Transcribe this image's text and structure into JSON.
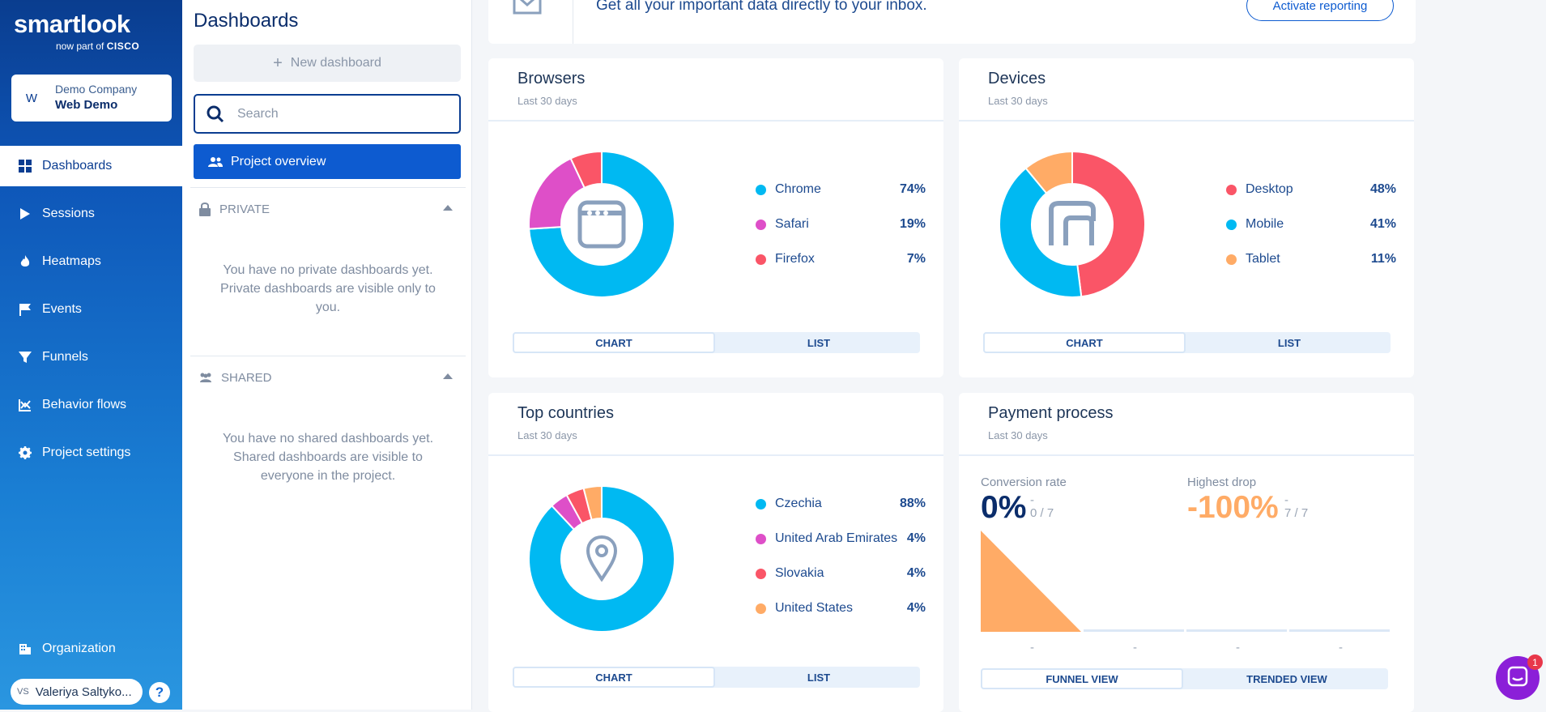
{
  "logo": {
    "brand": "smartlook",
    "sub_prefix": "now part of",
    "sub_brand": "CISCO"
  },
  "company": {
    "avatar": "W",
    "name": "Demo Company",
    "project": "Web Demo"
  },
  "nav": [
    {
      "label": "Dashboards",
      "icon": "grid-icon",
      "active": true
    },
    {
      "label": "Sessions",
      "icon": "play-icon"
    },
    {
      "label": "Heatmaps",
      "icon": "flame-icon"
    },
    {
      "label": "Events",
      "icon": "flag-icon"
    },
    {
      "label": "Funnels",
      "icon": "funnel-icon"
    },
    {
      "label": "Behavior flows",
      "icon": "flow-icon"
    },
    {
      "label": "Project settings",
      "icon": "gear-icon"
    }
  ],
  "organization": {
    "label": "Organization",
    "icon": "building-icon"
  },
  "user": {
    "initials": "VS",
    "name": "Valeriya Saltyko..."
  },
  "help": "?",
  "dashboards": {
    "title": "Dashboards",
    "new_label": "New dashboard",
    "search_placeholder": "Search",
    "project_overview": "Project overview",
    "private": {
      "label": "PRIVATE",
      "empty": "You have no private dashboards yet. Private dashboards are visible only to you."
    },
    "shared": {
      "label": "SHARED",
      "empty": "You have no shared dashboards yet. Shared dashboards are visible to everyone in the project."
    }
  },
  "reporting": {
    "text": "Get all your important data directly to your inbox.",
    "button": "Activate reporting"
  },
  "colors": {
    "blue": "#00b9f2",
    "magenta": "#de4fc8",
    "red": "#fa5567",
    "orange": "#ffab66",
    "accent": "#0d5bd0"
  },
  "cards": {
    "browsers": {
      "title": "Browsers",
      "subtitle": "Last 30 days",
      "center_icon": "browser-icon",
      "items": [
        {
          "label": "Chrome",
          "pct": "74%",
          "color": "#00b9f2"
        },
        {
          "label": "Safari",
          "pct": "19%",
          "color": "#de4fc8"
        },
        {
          "label": "Firefox",
          "pct": "7%",
          "color": "#fa5567"
        }
      ],
      "tabs": [
        "CHART",
        "LIST"
      ]
    },
    "devices": {
      "title": "Devices",
      "subtitle": "Last 30 days",
      "center_icon": "device-icon",
      "items": [
        {
          "label": "Desktop",
          "pct": "48%",
          "color": "#fa5567"
        },
        {
          "label": "Mobile",
          "pct": "41%",
          "color": "#00b9f2"
        },
        {
          "label": "Tablet",
          "pct": "11%",
          "color": "#ffab66"
        }
      ],
      "tabs": [
        "CHART",
        "LIST"
      ]
    },
    "countries": {
      "title": "Top countries",
      "subtitle": "Last 30 days",
      "center_icon": "location-pin-icon",
      "items": [
        {
          "label": "Czechia",
          "pct": "88%",
          "color": "#00b9f2"
        },
        {
          "label": "United Arab Emirates",
          "pct": "4%",
          "color": "#de4fc8"
        },
        {
          "label": "Slovakia",
          "pct": "4%",
          "color": "#fa5567"
        },
        {
          "label": "United States",
          "pct": "4%",
          "color": "#ffab66"
        }
      ],
      "tabs": [
        "CHART",
        "LIST"
      ]
    },
    "payment": {
      "title": "Payment process",
      "subtitle": "Last 30 days",
      "conversion_label": "Conversion rate",
      "conversion_value": "0%",
      "conversion_dash": "-",
      "conversion_ratio": "0 / 7",
      "drop_label": "Highest drop",
      "drop_value": "-100%",
      "drop_dash": "-",
      "drop_ratio": "7 / 7",
      "step_labels": [
        "-",
        "-",
        "-",
        "-"
      ],
      "tabs": [
        "FUNNEL VIEW",
        "TRENDED VIEW"
      ]
    }
  },
  "launcher": {
    "badge": "1"
  }
}
